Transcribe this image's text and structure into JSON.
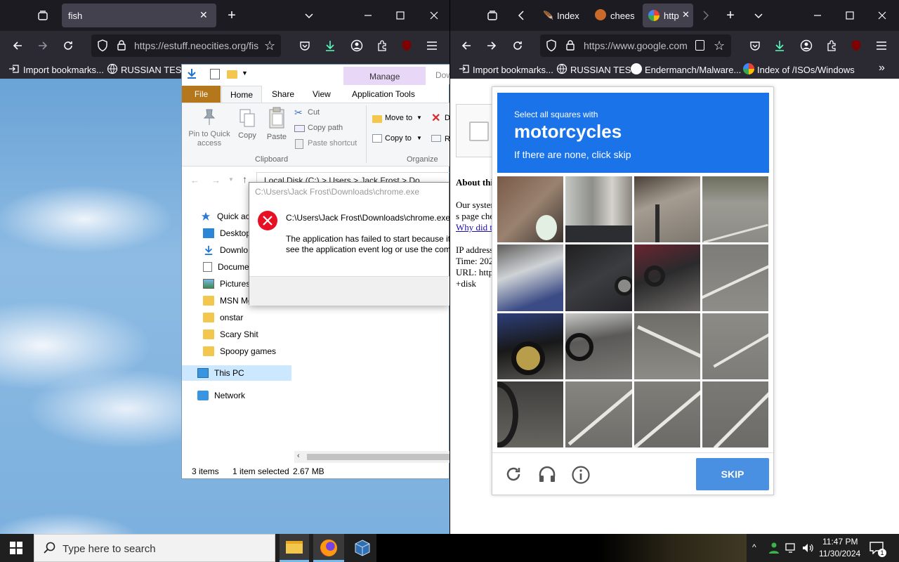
{
  "left_browser": {
    "tab_title": "fish",
    "url": "https://estuff.neocities.org/fis",
    "bookmarks": [
      "Import bookmarks...",
      "RUSSIAN TEST"
    ]
  },
  "right_browser": {
    "tabs": [
      "Index",
      "chees",
      "http"
    ],
    "url": "https://www.google.com",
    "bookmarks": [
      "Import bookmarks...",
      "RUSSIAN TEST",
      "Endermanch/Malware...",
      "Index of /ISOs/Windows"
    ]
  },
  "explorer": {
    "ribbon_tabs": [
      "File",
      "Home",
      "Share",
      "View",
      "Application Tools"
    ],
    "manage_label": "Manage",
    "down_label": "Dow",
    "clipboard": {
      "pin": "Pin to Quick access",
      "copy": "Copy",
      "paste": "Paste",
      "cut": "Cut",
      "copy_path": "Copy path",
      "paste_shortcut": "Paste shortcut",
      "group": "Clipboard"
    },
    "organize": {
      "move_to": "Move to",
      "copy_to": "Copy to",
      "delete": "D",
      "rename": "R",
      "group": "Organize"
    },
    "breadcrumb": "Local Disk (C:)  >  Users  >  Jack Frost  >  Do",
    "nav": [
      "Quick acc",
      "Desktop",
      "Downlo",
      "Docume",
      "Pictures",
      "MSN Me",
      "onstar",
      "Scary Shit",
      "Spoopy games",
      "This PC",
      "Network"
    ],
    "status": {
      "items": "3 items",
      "selected": "1 item selected",
      "size": "2.67 MB"
    }
  },
  "error_dialog": {
    "title": "C:\\Users\\Jack Frost\\Downloads\\chrome.exe",
    "heading": "C:\\Users\\Jack Frost\\Downloads\\chrome.exe",
    "body1": "The application has failed to start because its",
    "body2": "see the application event log or use the comm"
  },
  "google_page": {
    "about": "About thi",
    "lines": [
      "Our syster",
      "s page che"
    ],
    "link": "Why did t",
    "ip": "IP address",
    "time": "Time: 202",
    "url": "URL: http",
    "disk": "+disk"
  },
  "captcha": {
    "instruction": "Select all squares with",
    "target": "motorcycles",
    "hint": "If there are none, click skip",
    "skip": "SKIP",
    "header_color": "#1a73e8",
    "button_color": "#4a90e2"
  },
  "taskbar": {
    "search_placeholder": "Type here to search",
    "time": "11:47 PM",
    "date": "11/30/2024",
    "notif_count": "1"
  }
}
